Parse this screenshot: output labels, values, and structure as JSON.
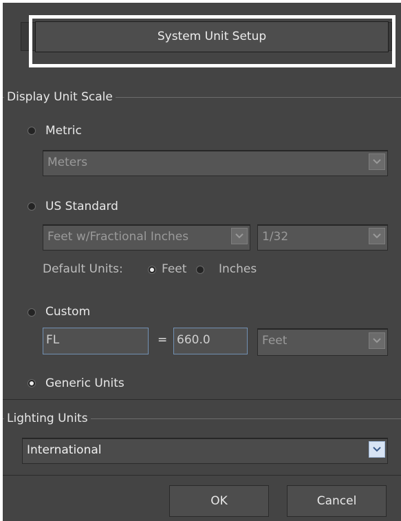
{
  "header": {
    "setup_button_label": "System Unit Setup"
  },
  "display_unit_scale": {
    "group_label": "Display Unit Scale",
    "metric": {
      "label": "Metric",
      "selected": false,
      "unit_value": "Meters"
    },
    "us_standard": {
      "label": "US Standard",
      "selected": false,
      "unit_value": "Feet w/Fractional Inches",
      "fraction_value": "1/32",
      "default_units_label": "Default Units:",
      "feet_label": "Feet",
      "inches_label": "Inches",
      "default_unit_selected": "Feet"
    },
    "custom": {
      "label": "Custom",
      "selected": false,
      "name_value": "FL",
      "equals": "=",
      "amount_value": "660.0",
      "unit_value": "Feet"
    },
    "generic": {
      "label": "Generic Units",
      "selected": true
    }
  },
  "lighting_units": {
    "group_label": "Lighting Units",
    "value": "International"
  },
  "footer": {
    "ok_label": "OK",
    "cancel_label": "Cancel"
  },
  "colors": {
    "dialog_bg": "#444444",
    "highlight_border": "#ffffff",
    "field_border": "#7291b3"
  }
}
